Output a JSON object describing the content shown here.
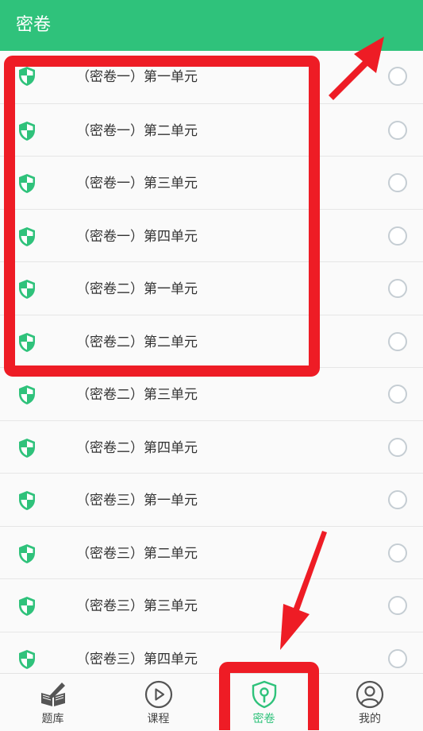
{
  "header": {
    "title": "密卷"
  },
  "list": {
    "items": [
      {
        "label": "（密卷一）第一单元"
      },
      {
        "label": "（密卷一）第二单元"
      },
      {
        "label": "（密卷一）第三单元"
      },
      {
        "label": "（密卷一）第四单元"
      },
      {
        "label": "（密卷二）第一单元"
      },
      {
        "label": "（密卷二）第二单元"
      },
      {
        "label": "（密卷二）第三单元"
      },
      {
        "label": "（密卷二）第四单元"
      },
      {
        "label": "（密卷三）第一单元"
      },
      {
        "label": "（密卷三）第二单元"
      },
      {
        "label": "（密卷三）第三单元"
      },
      {
        "label": "（密卷三）第四单元"
      }
    ]
  },
  "tabbar": {
    "tabs": [
      {
        "label": "题库",
        "icon": "book-pen-icon"
      },
      {
        "label": "课程",
        "icon": "play-circle-icon"
      },
      {
        "label": "密卷",
        "icon": "shield-lock-icon",
        "active": true
      },
      {
        "label": "我的",
        "icon": "user-circle-icon"
      }
    ]
  },
  "colors": {
    "accent": "#2fc27b",
    "annotation": "#ee1c25",
    "radio_border": "#c5cdd3"
  }
}
